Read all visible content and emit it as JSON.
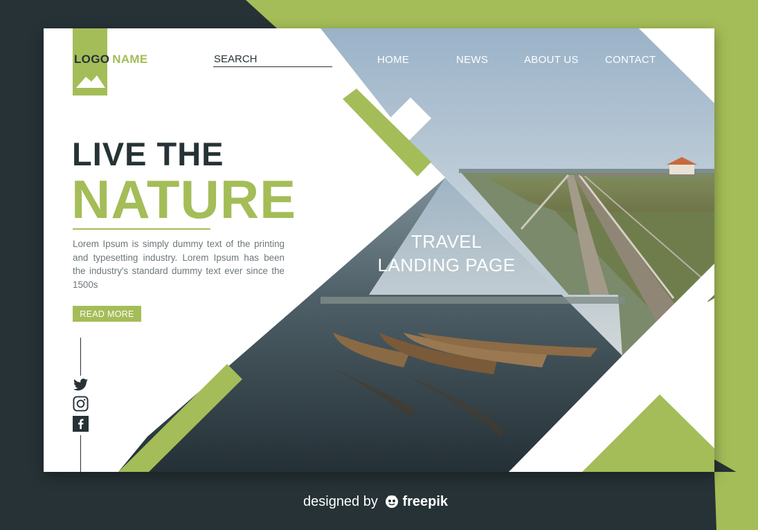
{
  "logo": {
    "word1": "LOGO",
    "word2": "NAME",
    "icon": "mountain-icon"
  },
  "search": {
    "placeholder": "SEARCH"
  },
  "nav": {
    "items": [
      "HOME",
      "NEWS",
      "ABOUT US",
      "CONTACT"
    ]
  },
  "hero": {
    "line1": "LIVE THE",
    "line2": "NATURE",
    "body": "Lorem Ipsum is simply dummy text of the printing and typesetting industry. Lorem Ipsum has been the industry's standard dummy text ever since the 1500s",
    "cta": "READ MORE"
  },
  "social": {
    "icons": [
      "twitter-icon",
      "instagram-icon",
      "facebook-icon"
    ]
  },
  "feature": {
    "line1": "TRAVEL",
    "line2": "LANDING PAGE"
  },
  "credit": {
    "prefix": "designed by",
    "brand": "freepik",
    "icon": "freepik-mascot-icon"
  },
  "colors": {
    "accent": "#a4bd58",
    "dark": "#263236",
    "white": "#ffffff",
    "body_text": "#6e777a"
  }
}
